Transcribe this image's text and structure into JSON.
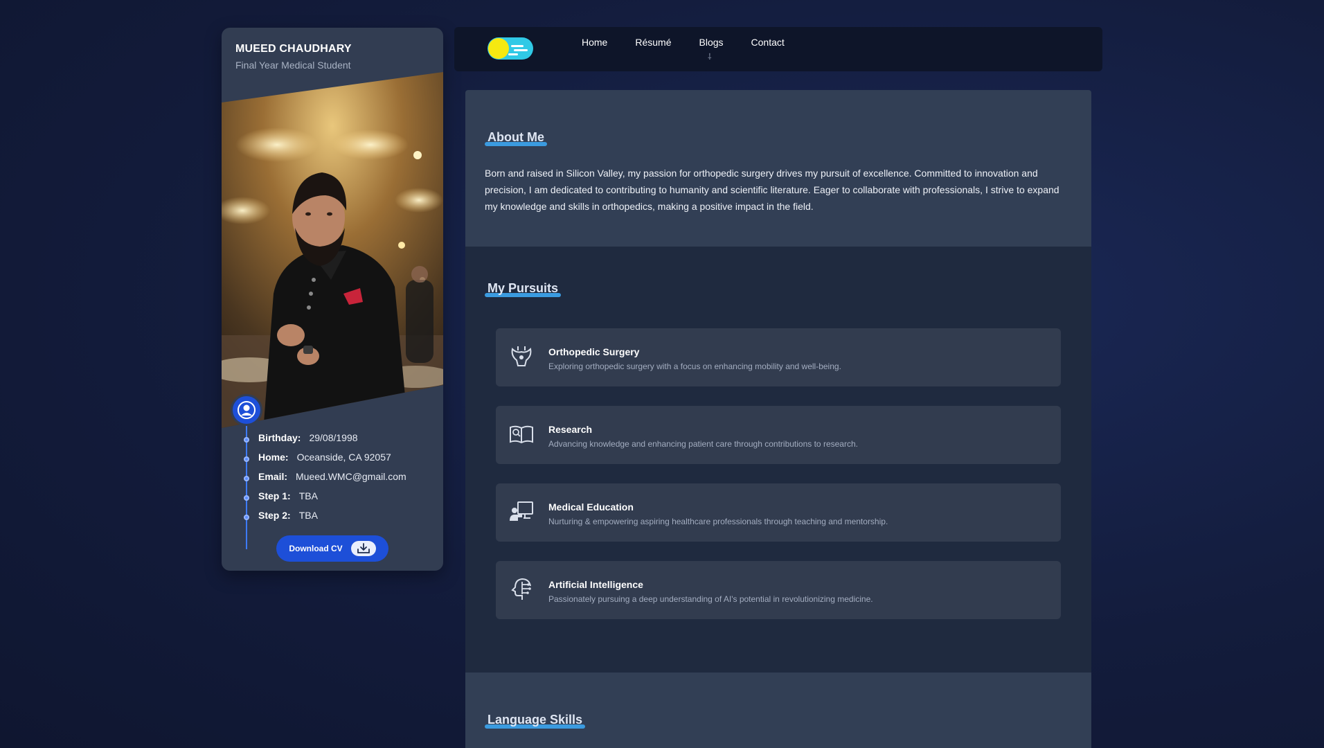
{
  "profile": {
    "name": "MUEED CHAUDHARY",
    "title": "Final Year Medical Student",
    "info": [
      {
        "label": "Birthday:",
        "value": "29/08/1998"
      },
      {
        "label": "Home:",
        "value": "Oceanside, CA 92057"
      },
      {
        "label": "Email:",
        "value": "Mueed.WMC@gmail.com"
      },
      {
        "label": "Step 1:",
        "value": "TBA"
      },
      {
        "label": "Step 2:",
        "value": "TBA"
      }
    ],
    "download_label": "Download CV",
    "icons": {
      "avatar": "user-icon",
      "download": "download-icon"
    }
  },
  "nav": {
    "links": [
      "Home",
      "Résumé",
      "Blogs",
      "Contact"
    ],
    "blogs_caret": "⸸",
    "colors": {
      "toggle_bg": "#30c9e6",
      "toggle_sun": "#f5e911"
    }
  },
  "about": {
    "heading": "About Me",
    "text": "Born and raised in Silicon Valley, my passion for orthopedic surgery drives my pursuit of excellence. Committed to innovation and precision, I am dedicated to contributing to humanity and scientific literature. Eager to collaborate with professionals, I strive to expand my knowledge and skills in orthopedics, making a positive impact in the field."
  },
  "pursuits": {
    "heading": "My Pursuits",
    "items": [
      {
        "title": "Orthopedic Surgery",
        "desc": "Exploring orthopedic surgery with a focus on enhancing mobility and well-being.",
        "icon": "pelvis-bone-icon"
      },
      {
        "title": "Research",
        "desc": "Advancing knowledge and enhancing patient care through contributions to research.",
        "icon": "open-book-icon"
      },
      {
        "title": "Medical Education",
        "desc": "Nurturing & empowering aspiring healthcare professionals through teaching and mentorship.",
        "icon": "teacher-board-icon"
      },
      {
        "title": "Artificial Intelligence",
        "desc": "Passionately pursuing a deep understanding of AI's potential in revolutionizing medicine.",
        "icon": "ai-head-icon"
      }
    ]
  },
  "languages": {
    "heading": "Language Skills"
  },
  "theme": {
    "accent": "#1d4fd8",
    "heading_underline": "#3b9be0",
    "card_bg": "#323c4f"
  }
}
